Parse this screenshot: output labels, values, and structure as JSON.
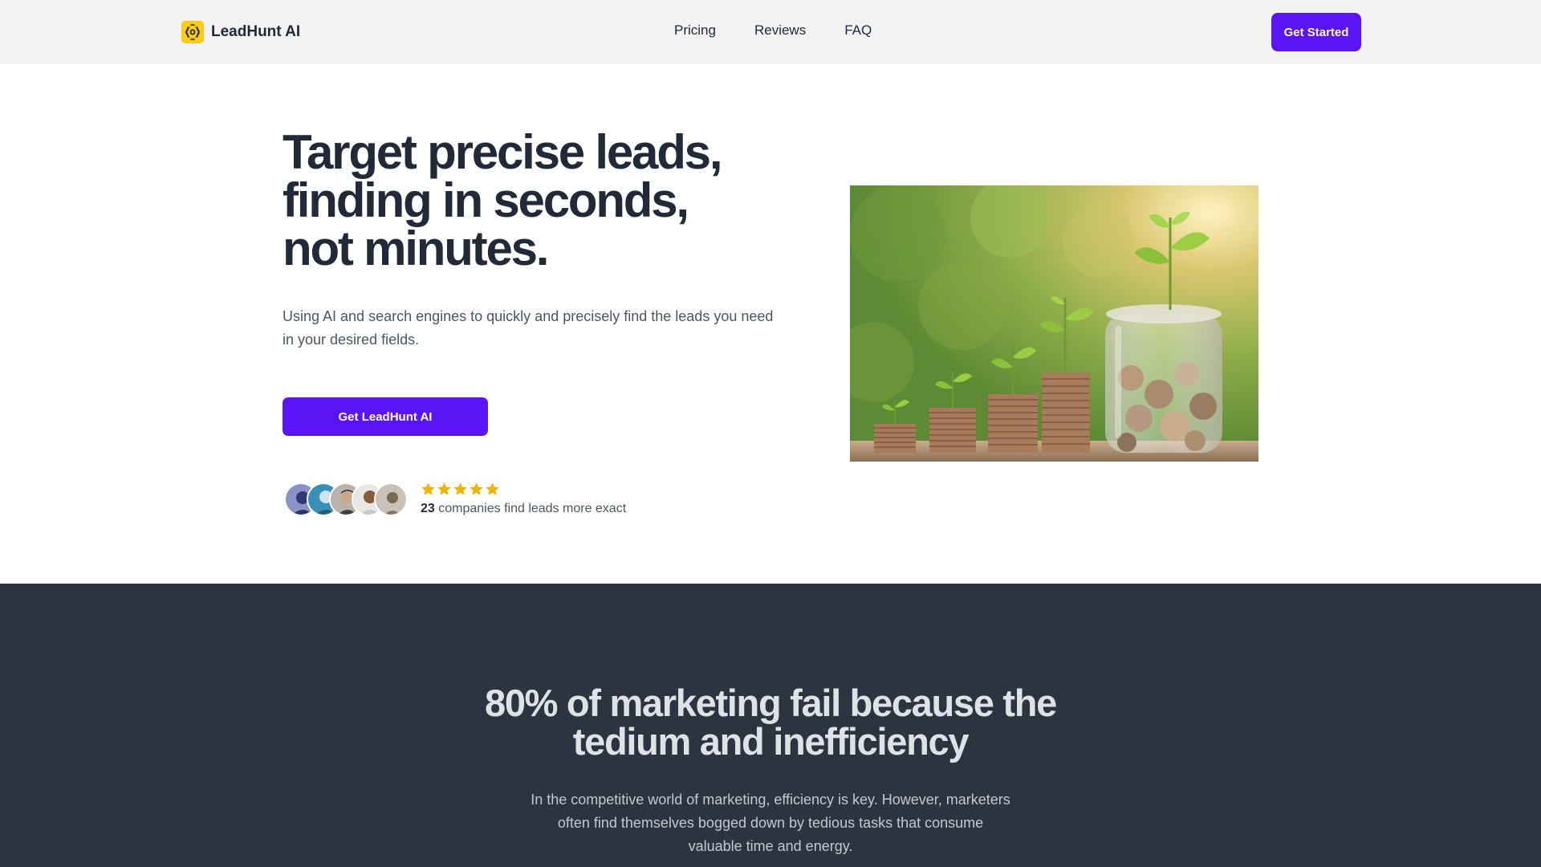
{
  "header": {
    "brand_name": "LeadHunt AI",
    "logo_icon": "scan-icon",
    "nav": [
      {
        "label": "Pricing"
      },
      {
        "label": "Reviews"
      },
      {
        "label": "FAQ"
      }
    ],
    "cta_label": "Get Started"
  },
  "hero": {
    "title_lines": [
      "Target precise leads,",
      "finding in seconds,",
      "not minutes."
    ],
    "subtitle": "Using AI and search engines to quickly and precisely find the leads you need in your desired fields.",
    "cta_label": "Get LeadHunt AI",
    "rating_stars": 5,
    "companies_count": "23",
    "companies_text": "companies find leads more exact",
    "image_subject": "coin stacks with growing plants and a jar of coins"
  },
  "problem": {
    "title_lines": [
      "80% of marketing fail because the",
      "tedium and inefficiency"
    ],
    "text": "In the competitive world of marketing, efficiency is key. However, marketers often find themselves bogged down by tedious tasks that consume valuable time and energy."
  },
  "colors": {
    "accent": "#5b14f5",
    "logo": "#facc15",
    "star": "#f0b400",
    "dark_bg": "#2e3340",
    "header_bg": "#f2f2f2"
  }
}
